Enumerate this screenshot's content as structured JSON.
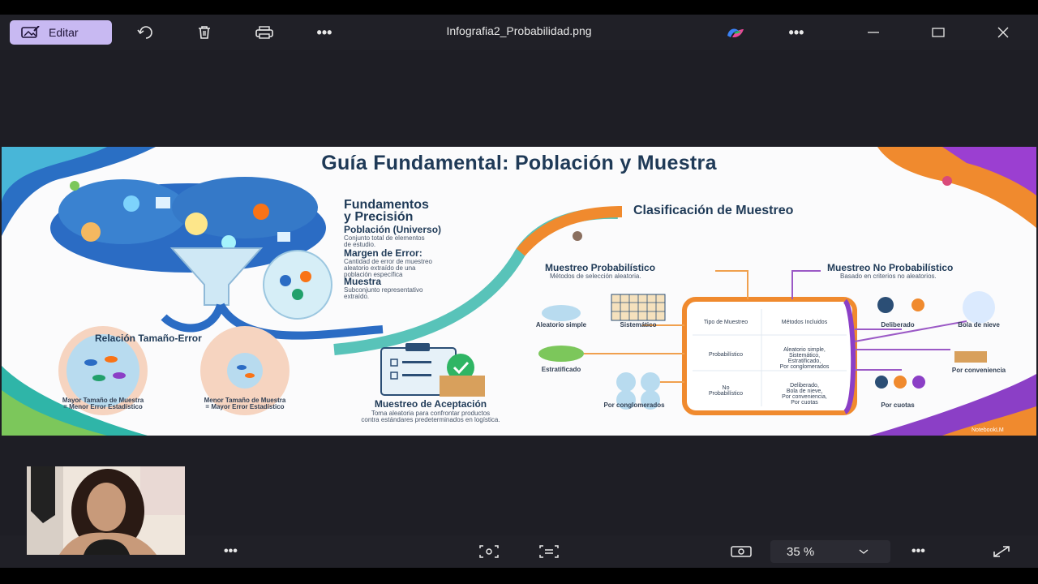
{
  "window": {
    "edit_label": "Editar",
    "file_name": "Infografia2_Probabilidad.png",
    "more_label": "•••",
    "minimize": "—",
    "close": "✕"
  },
  "bottom": {
    "more_left": "•••",
    "zoom_value": "35 %",
    "more_right": "•••"
  },
  "infographic": {
    "title": "Guía Fundamental: Población y Muestra",
    "fundamentos_title_1": "Fundamentos",
    "fundamentos_title_2": "y Precisión",
    "poblacion_title": "Población (Universo)",
    "poblacion_desc_1": "Conjunto total de elementos",
    "poblacion_desc_2": "de estudio.",
    "margen_title": "Margen de Error:",
    "margen_desc_1": "Cantidad de error de muestreo",
    "margen_desc_2": "aleatorio extraído de una",
    "margen_desc_3": "población específica",
    "muestra_title": "Muestra",
    "muestra_desc_1": "Subconjunto representativo",
    "muestra_desc_2": "extraído.",
    "relacion_title": "Relación Tamaño-Error",
    "mayor_1": "Mayor Tamaño de Muestra",
    "mayor_2": "= Menor Error Estadístico",
    "menor_1": "Menor Tamaño de Muestra",
    "menor_2": "= Mayor Error Estadístico",
    "aceptacion_title": "Muestreo de Aceptación",
    "aceptacion_desc_1": "Toma aleatoria para confrontar productos",
    "aceptacion_desc_2": "contra estándares predeterminados en logística.",
    "clasificacion_title": "Clasificación de Muestreo",
    "prob_title": "Muestreo Probabilístico",
    "prob_desc": "Métodos de selección aleatoria.",
    "noprob_title": "Muestreo No Probabilístico",
    "noprob_desc": "Basado en criterios no aleatorios.",
    "aleatorio": "Aleatorio simple",
    "sistematico": "Sistemático",
    "estratificado": "Estratificado",
    "conglomerados": "Por conglomerados",
    "deliberado": "Deliberado",
    "bola": "Bola de nieve",
    "conveniencia": "Por conveniencia",
    "cuotas": "Por cuotas",
    "table_h1": "Tipo de Muestreo",
    "table_h2": "Métodos Incluidos",
    "table_r1c1": "Probabilístico",
    "table_r1c2_1": "Aleatorio simple,",
    "table_r1c2_2": "Sistemático,",
    "table_r1c2_3": "Estratificado,",
    "table_r1c2_4": "Por conglomerados",
    "table_r2c1_1": "No",
    "table_r2c1_2": "Probabilístico",
    "table_r2c2_1": "Deliberado,",
    "table_r2c2_2": "Bola de nieve,",
    "table_r2c2_3": "Por conveniencia,",
    "table_r2c2_4": "Por cuotas",
    "watermark": "NotebookLM"
  },
  "colors": {
    "accent": "#c8b9f2",
    "orange": "#f08a2e",
    "purple": "#8b3fc6",
    "teal": "#2fb5a8",
    "blue": "#2b6cc4"
  }
}
